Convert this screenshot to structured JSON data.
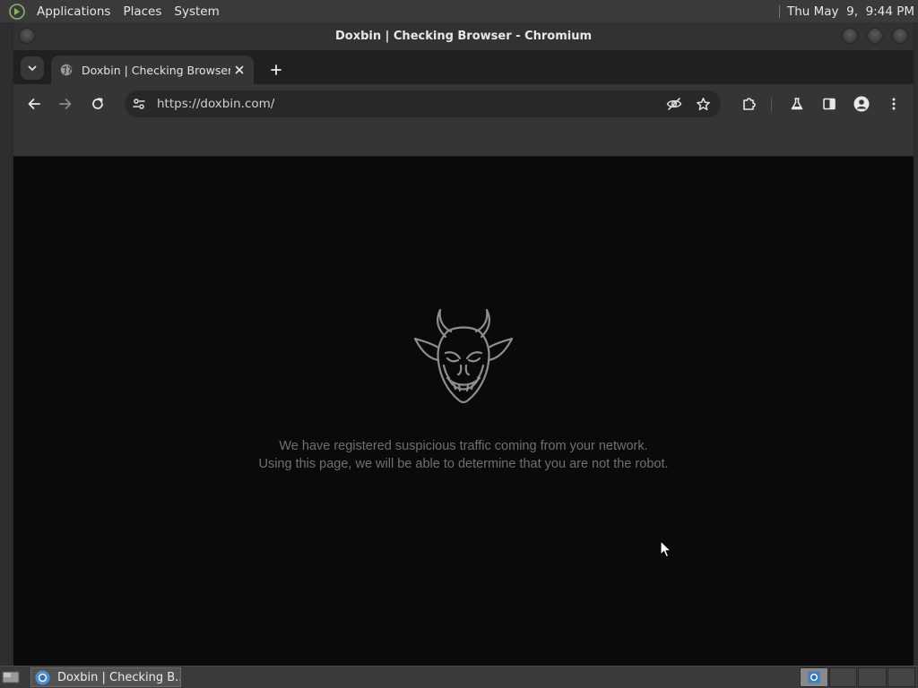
{
  "top_panel": {
    "menus": [
      {
        "label": "Applications"
      },
      {
        "label": "Places"
      },
      {
        "label": "System"
      }
    ],
    "clock": "Thu May  9,  9:44 PM"
  },
  "window": {
    "title": "Doxbin | Checking Browser - Chromium"
  },
  "tab": {
    "title": "Doxbin | Checking Browser",
    "favicon": "globe-icon"
  },
  "toolbar": {
    "url": "https://doxbin.com/",
    "icons": [
      "back-arrow-icon",
      "forward-arrow-icon",
      "reload-icon",
      "site-settings-icon",
      "eye-slash-icon",
      "star-icon",
      "puzzle-piece-icon",
      "flask-icon",
      "side-panel-icon",
      "profile-icon",
      "kebab-menu-icon"
    ]
  },
  "page": {
    "logo": "devil-head-icon",
    "message_line1": "We have registered suspicious traffic coming from your network.",
    "message_line2": "Using this page, we will be able to determine that you are not the robot."
  },
  "taskbar": {
    "task_label": "Doxbin | Checking B..."
  },
  "colors": {
    "page_background": "#0a0a0a",
    "toolbar_background": "#353535",
    "message_text": "#707070",
    "panel_background": "#3a3a3a"
  }
}
